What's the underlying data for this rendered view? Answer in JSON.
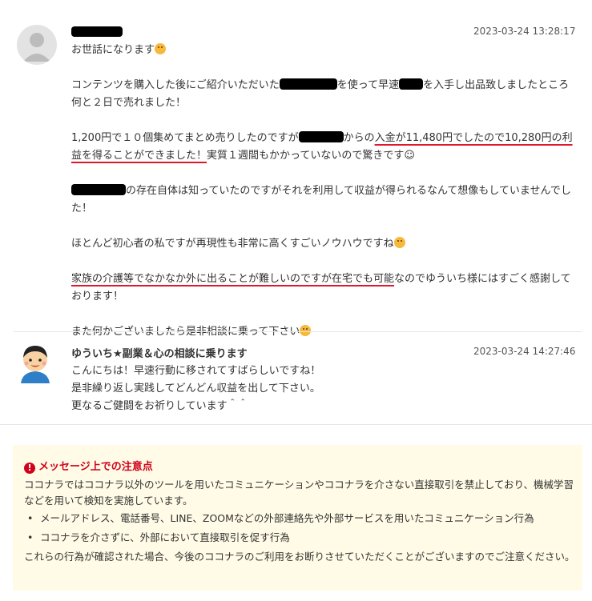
{
  "messages": [
    {
      "timestamp": "2023-03-24 13:28:17",
      "p1": "お世話になります",
      "p2a": "コンテンツを購入した後にご紹介いただいた",
      "p2b": "を使って早速",
      "p2c": "を入手し出品致しましたところ何と２日で売れました！",
      "p3a": "1,200円で１０個集めてまとめ売りしたのですが",
      "p3b": "からの",
      "p3c": "入金が11,480円でしたので10,280円の利益を得ることができました！",
      "p3d": "実質１週間もかかっていないので驚きです☺",
      "p4": "の存在自体は知っていたのですがそれを利用して収益が得られるなんて想像もしていませんでした！",
      "p5": "ほとんど初心者の私ですが再現性も非常に高くすごいノウハウですね",
      "p6a": "家族の介護等でなかなか外に出ることが難しいのですが在宅でも可能",
      "p6b": "なのでゆういち様にはすごく感謝しております！",
      "p7": "また何かございましたら是非相談に乗って下さい"
    },
    {
      "sender": "ゆういち★副業＆心の相談に乗ります",
      "timestamp": "2023-03-24 14:27:46",
      "line1": "こんにちは！早速行動に移されてすばらしいですね！",
      "line2": "是非繰り返し実践してどんどん収益を出して下さい。",
      "line3": "更なるご健闘をお祈りしています＾＾"
    }
  ],
  "notice": {
    "title": "メッセージ上での注意点",
    "intro": "ココナラではココナラ以外のツールを用いたコミュニケーションやココナラを介さない直接取引を禁止しており、機械学習などを用いて検知を実施しています。",
    "bullets": [
      "メールアドレス、電話番号、LINE、ZOOMなどの外部連絡先や外部サービスを用いたコミュニケーション行為",
      "ココナラを介さずに、外部において直接取引を促す行為"
    ],
    "footer": "これらの行為が確認された場合、今後のココナラのご利用をお断りさせていただくことがございますのでご注意ください。",
    "accent_color": "#d0021b",
    "background": "#fffbe6"
  }
}
